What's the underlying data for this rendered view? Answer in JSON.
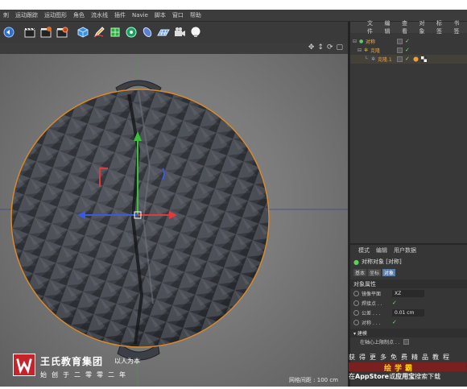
{
  "menubar": {
    "items": [
      "刺",
      "运动跟踪",
      "运动图形",
      "角色",
      "流水线",
      "插件",
      "Navie",
      "脚本",
      "窗口",
      "帮助"
    ]
  },
  "toolbar": {
    "icons": [
      "undo-arrow-icon",
      "clapper-icon",
      "render-view-icon",
      "render-settings-icon",
      "cube-icon",
      "pen-icon",
      "subdivision-icon",
      "array-icon",
      "deformer-icon",
      "floor-icon",
      "camera-icon",
      "light-icon"
    ]
  },
  "viewport": {
    "grid_label": "网格间距 : 100 cm"
  },
  "object_manager": {
    "tabs": [
      "文件",
      "编辑",
      "查看",
      "对象",
      "标签",
      "书签"
    ],
    "objects": [
      {
        "name": "对称",
        "level": 0,
        "selected": true
      },
      {
        "name": "克隆",
        "level": 1,
        "selected": false
      },
      {
        "name": "克隆.1",
        "level": 2,
        "selected": false
      }
    ]
  },
  "attributes": {
    "tabs": [
      "模式",
      "编辑",
      "用户数据"
    ],
    "title": "对称对象 [对称]",
    "subtabs": [
      "基本",
      "坐标",
      "对象"
    ],
    "active_subtab": "对象",
    "section": "对象属性",
    "props": [
      {
        "label": "镜像平面",
        "value": "XZ"
      },
      {
        "label": "焊接点 . .",
        "value": "✓"
      },
      {
        "label": "公差 . . .",
        "value": "0.01 cm"
      },
      {
        "label": "对称 . . .",
        "value": "✓"
      }
    ],
    "build_label": "▾ 建模",
    "weld_label": "在轴心上限制点 . ."
  },
  "watermark": {
    "title": "王氏教育集团",
    "slogan": "以人为本",
    "sub": "始创于二零零二年"
  },
  "promo": {
    "line1": "获得更多免费精品教程",
    "line2": "绘学霸",
    "line3_pre": "在",
    "line3_b1": "AppStore",
    "line3_mid": "或",
    "line3_b2": "应用宝",
    "line3_post": "搜索下载"
  },
  "colors": {
    "ui_dark": "#3a3a3a",
    "object_name": "#e8a03a",
    "selection_outline": "#d98a2a",
    "axis_x": "#e03a3a",
    "axis_y": "#3ac03a",
    "axis_z": "#3a5ae0",
    "brand_red": "#c6242b"
  }
}
